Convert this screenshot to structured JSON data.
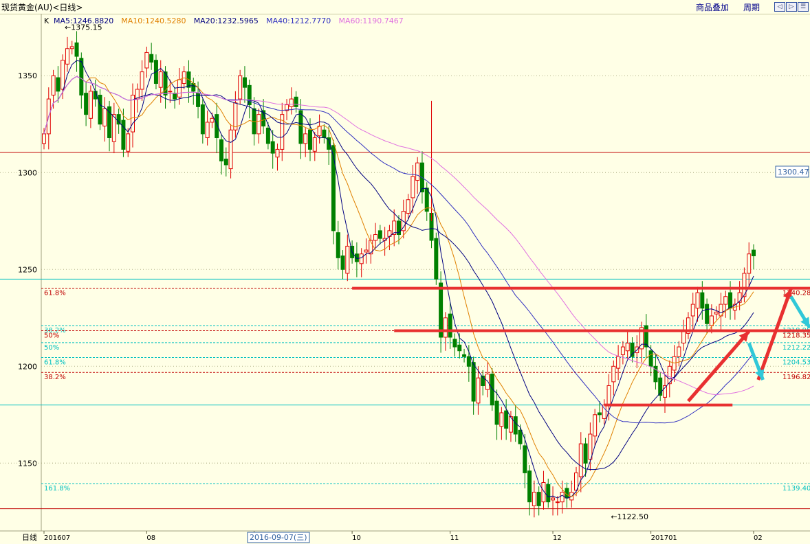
{
  "window": {
    "title": "现货黄金(AU)<日线>"
  },
  "toolbar": {
    "overlay_label": "商品叠加",
    "period_label": "周期",
    "nav_icons": [
      "arrow-left-icon",
      "arrow-right-icon",
      "arrow-up-icon",
      "menu-icon"
    ]
  },
  "ma_legend": {
    "prefix": "K",
    "items": [
      {
        "text": "MA5:1246.8820",
        "color": "#000080"
      },
      {
        "text": "MA10:1240.5280",
        "color": "#e08000"
      },
      {
        "text": "MA20:1232.5965",
        "color": "#000080"
      },
      {
        "text": "MA40:1212.7770",
        "color": "#3030c0"
      },
      {
        "text": "MA60:1190.7467",
        "color": "#e070e0"
      }
    ]
  },
  "bottom_axis": {
    "label": "日线",
    "highlight": "2016-09-07(三)"
  },
  "colors": {
    "up": "#e00000",
    "down": "#008000",
    "bg": "#ffffe6",
    "grid": "#b4b48c",
    "fib_red": "#c00000",
    "fib_cyan": "#00c0c0",
    "arrow_red": "#e83030",
    "arrow_cyan": "#30c8d8"
  },
  "chart_data": {
    "type": "candlestick",
    "ylim": [
      1115,
      1382
    ],
    "y_ticks": [
      1150,
      1200,
      1250,
      1300,
      1350
    ],
    "x_ticks": [
      {
        "label": "201607",
        "idx": 0
      },
      {
        "label": "08",
        "idx": 22
      },
      {
        "label": "09",
        "idx": 45
      },
      {
        "label": "10",
        "idx": 66
      },
      {
        "label": "11",
        "idx": 87
      },
      {
        "label": "12",
        "idx": 109
      },
      {
        "label": "201701",
        "idx": 130
      },
      {
        "label": "02",
        "idx": 152
      }
    ],
    "annotations": [
      {
        "text": "1375.15",
        "price": 1375.15,
        "idx": 5
      },
      {
        "text": "1122.50",
        "price": 1122.5,
        "idx": 122
      }
    ],
    "price_tag": 1300.47,
    "closes": [
      1320,
      1338,
      1350,
      1342,
      1358,
      1364,
      1365,
      1360,
      1340,
      1330,
      1342,
      1338,
      1325,
      1333,
      1318,
      1330,
      1325,
      1312,
      1320,
      1340,
      1343,
      1352,
      1362,
      1357,
      1346,
      1352,
      1340,
      1342,
      1338,
      1348,
      1352,
      1344,
      1342,
      1334,
      1320,
      1326,
      1328,
      1318,
      1306,
      1304,
      1322,
      1336,
      1350,
      1344,
      1335,
      1320,
      1330,
      1324,
      1315,
      1310,
      1312,
      1330,
      1335,
      1338,
      1334,
      1315,
      1320,
      1312,
      1318,
      1324,
      1318,
      1312,
      1270,
      1256,
      1250,
      1262,
      1256,
      1254,
      1258,
      1260,
      1265,
      1268,
      1266,
      1266,
      1270,
      1275,
      1268,
      1280,
      1286,
      1298,
      1305,
      1290,
      1280,
      1265,
      1245,
      1215,
      1225,
      1215,
      1210,
      1208,
      1205,
      1200,
      1182,
      1194,
      1190,
      1196,
      1180,
      1170,
      1176,
      1168,
      1174,
      1165,
      1160,
      1145,
      1130,
      1135,
      1128,
      1140,
      1130,
      1132,
      1130,
      1135,
      1132,
      1135,
      1145,
      1160,
      1150,
      1165,
      1175,
      1175,
      1180,
      1190,
      1200,
      1205,
      1210,
      1212,
      1205,
      1210,
      1220,
      1210,
      1200,
      1192,
      1185,
      1190,
      1200,
      1205,
      1210,
      1218,
      1225,
      1232,
      1238,
      1230,
      1222,
      1226,
      1228,
      1232,
      1236,
      1230,
      1232,
      1238,
      1248,
      1258,
      1257
    ],
    "moving_averages": [
      {
        "name": "MA5",
        "period": 5,
        "color": "#000080"
      },
      {
        "name": "MA10",
        "period": 10,
        "color": "#e08000"
      },
      {
        "name": "MA20",
        "period": 20,
        "color": "#000080"
      },
      {
        "name": "MA40",
        "period": 40,
        "color": "#3030c0"
      },
      {
        "name": "MA60",
        "period": 60,
        "color": "#e070e0"
      }
    ],
    "horizontal_levels": [
      {
        "price": 1310.5,
        "color": "#c00000",
        "style": "solid"
      },
      {
        "price": 1245.0,
        "color": "#00c0c0",
        "style": "solid"
      },
      {
        "price": 1180.0,
        "color": "#00c0c0",
        "style": "solid"
      },
      {
        "price": 1126.5,
        "color": "#c00000",
        "style": "solid"
      },
      {
        "price": 1300.0,
        "color": "#b4b48c",
        "style": "dotted"
      },
      {
        "price": 1150.0,
        "color": "#b4b48c",
        "style": "dotted"
      }
    ],
    "fib_levels": [
      {
        "price": 1240.28,
        "left": "61.8%",
        "right": "1240.28",
        "color": "#c00000"
      },
      {
        "price": 1221.0,
        "left": "38.2%",
        "right": "1218.95",
        "color": "#00c0c0"
      },
      {
        "price": 1218.35,
        "left": "50%",
        "right": "1218.35",
        "color": "#c00000"
      },
      {
        "price": 1212.22,
        "left": "50%",
        "right": "1212.22",
        "color": "#00c0c0"
      },
      {
        "price": 1204.53,
        "left": "61.8%",
        "right": "1204.53",
        "color": "#00c0c0"
      },
      {
        "price": 1196.82,
        "left": "38.2%",
        "right": "1196.82",
        "color": "#c00000"
      },
      {
        "price": 1139.4,
        "left": "161.8%",
        "right": "1139.40",
        "color": "#00c0c0"
      }
    ],
    "drawn_lines": [
      {
        "from_idx": 66,
        "to_idx": 170,
        "price": 1240.28,
        "color": "#e83030"
      },
      {
        "from_idx": 75,
        "to_idx": 170,
        "price": 1218.35,
        "color": "#e83030"
      },
      {
        "from_idx": 120,
        "to_idx": 146,
        "price": 1180.0,
        "color": "#e83030"
      }
    ],
    "arrows": [
      {
        "from": [
          138,
          1182
        ],
        "to": [
          151,
          1218
        ],
        "color": "#e83030"
      },
      {
        "from": [
          153,
          1193
        ],
        "to": [
          160,
          1240
        ],
        "color": "#e83030"
      },
      {
        "from": [
          151,
          1212
        ],
        "to": [
          154,
          1193
        ],
        "color": "#30c8d8"
      },
      {
        "from": [
          160,
          1236
        ],
        "to": [
          164,
          1220
        ],
        "color": "#30c8d8"
      }
    ]
  }
}
